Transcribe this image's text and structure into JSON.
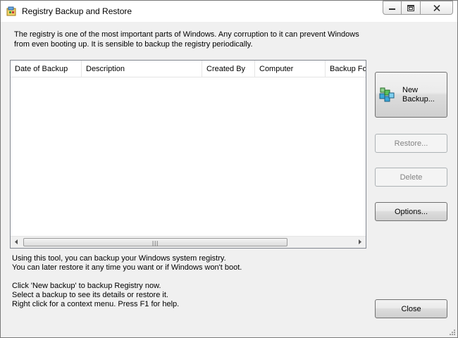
{
  "window": {
    "title": "Registry Backup and Restore",
    "icon": "registry-app-icon",
    "controls": [
      "minimize-icon",
      "maximize-icon",
      "close-icon"
    ]
  },
  "intro": {
    "line1": "The registry is one of the most important parts of Windows. Any corruption to it can prevent Windows",
    "line2": "from even booting up.  It is sensible to backup the registry periodically."
  },
  "list": {
    "columns": [
      "Date of Backup",
      "Description",
      "Created By",
      "Computer",
      "Backup Fol"
    ],
    "rows": [],
    "scrollbar_grip": "|||"
  },
  "buttons": {
    "new_backup_line1": "New",
    "new_backup_line2": "Backup...",
    "restore": "Restore...",
    "delete": "Delete",
    "options": "Options...",
    "close": "Close"
  },
  "info": {
    "line1": "Using this tool, you can backup your Windows system registry.",
    "line2": "You can later restore it any time you want or if Windows won't boot.",
    "line3": "Click 'New backup' to backup Registry now.",
    "line4": "Select a backup to see its details or restore it.",
    "line5": "Right click for a context menu. Press F1 for help."
  }
}
